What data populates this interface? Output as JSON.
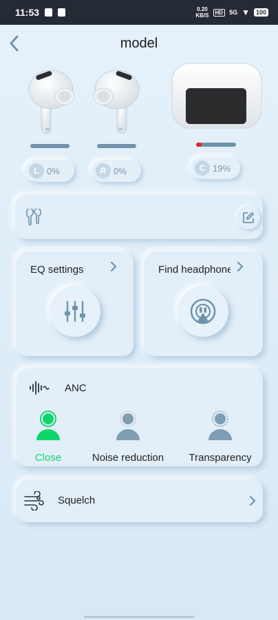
{
  "status_bar": {
    "time": "11:53",
    "net_speed_top": "0.20",
    "net_speed_bottom": "KB/S",
    "volte": "HD",
    "signal": "5G",
    "battery": "100"
  },
  "header": {
    "title": "model"
  },
  "buds": {
    "left": {
      "letter": "L",
      "percent": "0%",
      "level": 0.0
    },
    "right": {
      "letter": "R",
      "percent": "0%",
      "level": 0.0
    },
    "case": {
      "letter": "C",
      "percent": "19%",
      "level": 0.19
    }
  },
  "cards": {
    "eq": {
      "title": "EQ settings"
    },
    "find": {
      "title": "Find headphones"
    }
  },
  "anc": {
    "title": "ANC",
    "modes": [
      {
        "label": "Close",
        "active": true
      },
      {
        "label": "Noise reduction",
        "active": false
      },
      {
        "label": "Transparency",
        "active": false
      }
    ]
  },
  "squelch": {
    "label": "Squelch"
  },
  "colors": {
    "accent": "#0fd66a",
    "icon": "#7f9db3",
    "level_bar": "#6f93ab",
    "low_battery": "#e52222"
  }
}
